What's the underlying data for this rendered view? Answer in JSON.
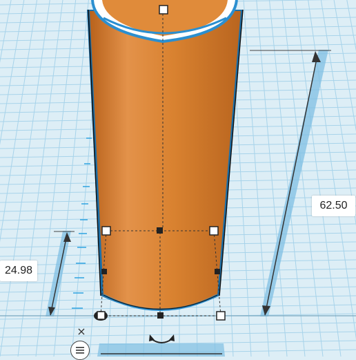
{
  "dimensions": {
    "height_value": "62.50",
    "elevation_value": "24.98"
  },
  "controls": {
    "close_symbol": "×"
  },
  "shape": {
    "name": "tube",
    "body_color": "#e08b3a",
    "edge_color": "#2b8fd0"
  },
  "colors": {
    "grid_background": "#ddeef6",
    "grid_line": "#9fd0e8",
    "dimension_band": "#7fbfe3"
  },
  "icons": [
    "close-icon",
    "menu-icon",
    "rotate-icon"
  ]
}
